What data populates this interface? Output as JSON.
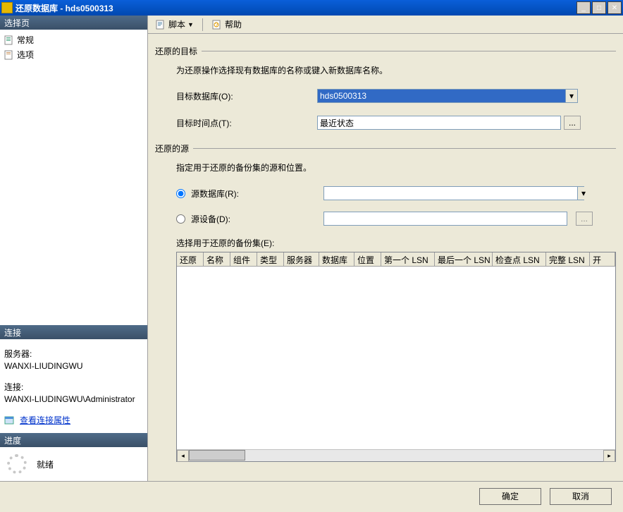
{
  "window": {
    "title": "还原数据库 - hds0500313"
  },
  "sidebar": {
    "select_page_header": "选择页",
    "pages": [
      "常规",
      "选项"
    ],
    "connection_header": "连接",
    "server_label": "服务器:",
    "server_value": "WANXI-LIUDINGWU",
    "conn_label": "连接:",
    "conn_value": "WANXI-LIUDINGWU\\Administrator",
    "view_conn_link": "查看连接属性",
    "progress_header": "进度",
    "progress_status": "就绪"
  },
  "toolbar": {
    "script": "脚本",
    "help": "帮助"
  },
  "target": {
    "heading": "还原的目标",
    "desc": "为还原操作选择现有数据库的名称或键入新数据库名称。",
    "db_label": "目标数据库(O):",
    "db_value": "hds0500313",
    "time_label": "目标时间点(T):",
    "time_value": "最近状态"
  },
  "source": {
    "heading": "还原的源",
    "desc": "指定用于还原的备份集的源和位置。",
    "radio_db": "源数据库(R):",
    "radio_db_value": "",
    "radio_device": "源设备(D):",
    "radio_device_value": "",
    "grid_label": "选择用于还原的备份集(E):",
    "columns": [
      "还原",
      "名称",
      "组件",
      "类型",
      "服务器",
      "数据库",
      "位置",
      "第一个 LSN",
      "最后一个 LSN",
      "检查点 LSN",
      "完整 LSN",
      "开"
    ]
  },
  "buttons": {
    "ok": "确定",
    "cancel": "取消",
    "ellipsis": "..."
  }
}
